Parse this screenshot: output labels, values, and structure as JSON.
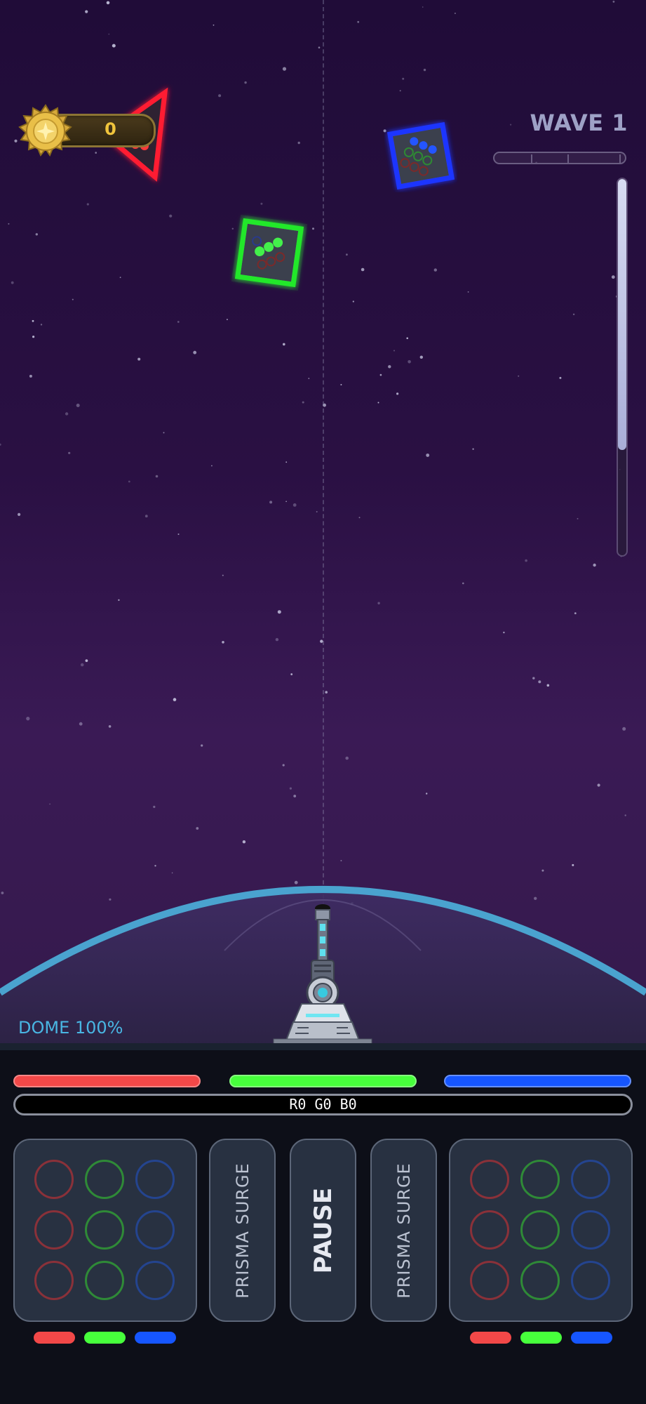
{
  "hud": {
    "coins": "0",
    "wave_label": "WAVE 1",
    "wave_progress_segments": 3,
    "charge_level_fraction": 0.72
  },
  "enemies": [
    {
      "shape": "triangle",
      "color": "#ff2a3d",
      "type": "red",
      "dots_lit": 3
    },
    {
      "shape": "square",
      "color": "#1f3cff",
      "type": "blue",
      "dots_lit": 3
    },
    {
      "shape": "square",
      "color": "#2bff2b",
      "type": "green",
      "dots_lit": 3
    }
  ],
  "dome": {
    "label": "DOME 100%",
    "health_percent": 100,
    "color": "#49b6e3"
  },
  "controls": {
    "colors": {
      "red": "#f24848",
      "green": "#47ff3c",
      "blue": "#1656ff"
    },
    "rgb_readout": "R0 G0 B0",
    "left_surge_label": "PRISMA SURGE",
    "pause_label": "PAUSE",
    "right_surge_label": "PRISMA SURGE"
  },
  "icons": [
    "coin-icon",
    "turret-icon",
    "dome-icon"
  ]
}
